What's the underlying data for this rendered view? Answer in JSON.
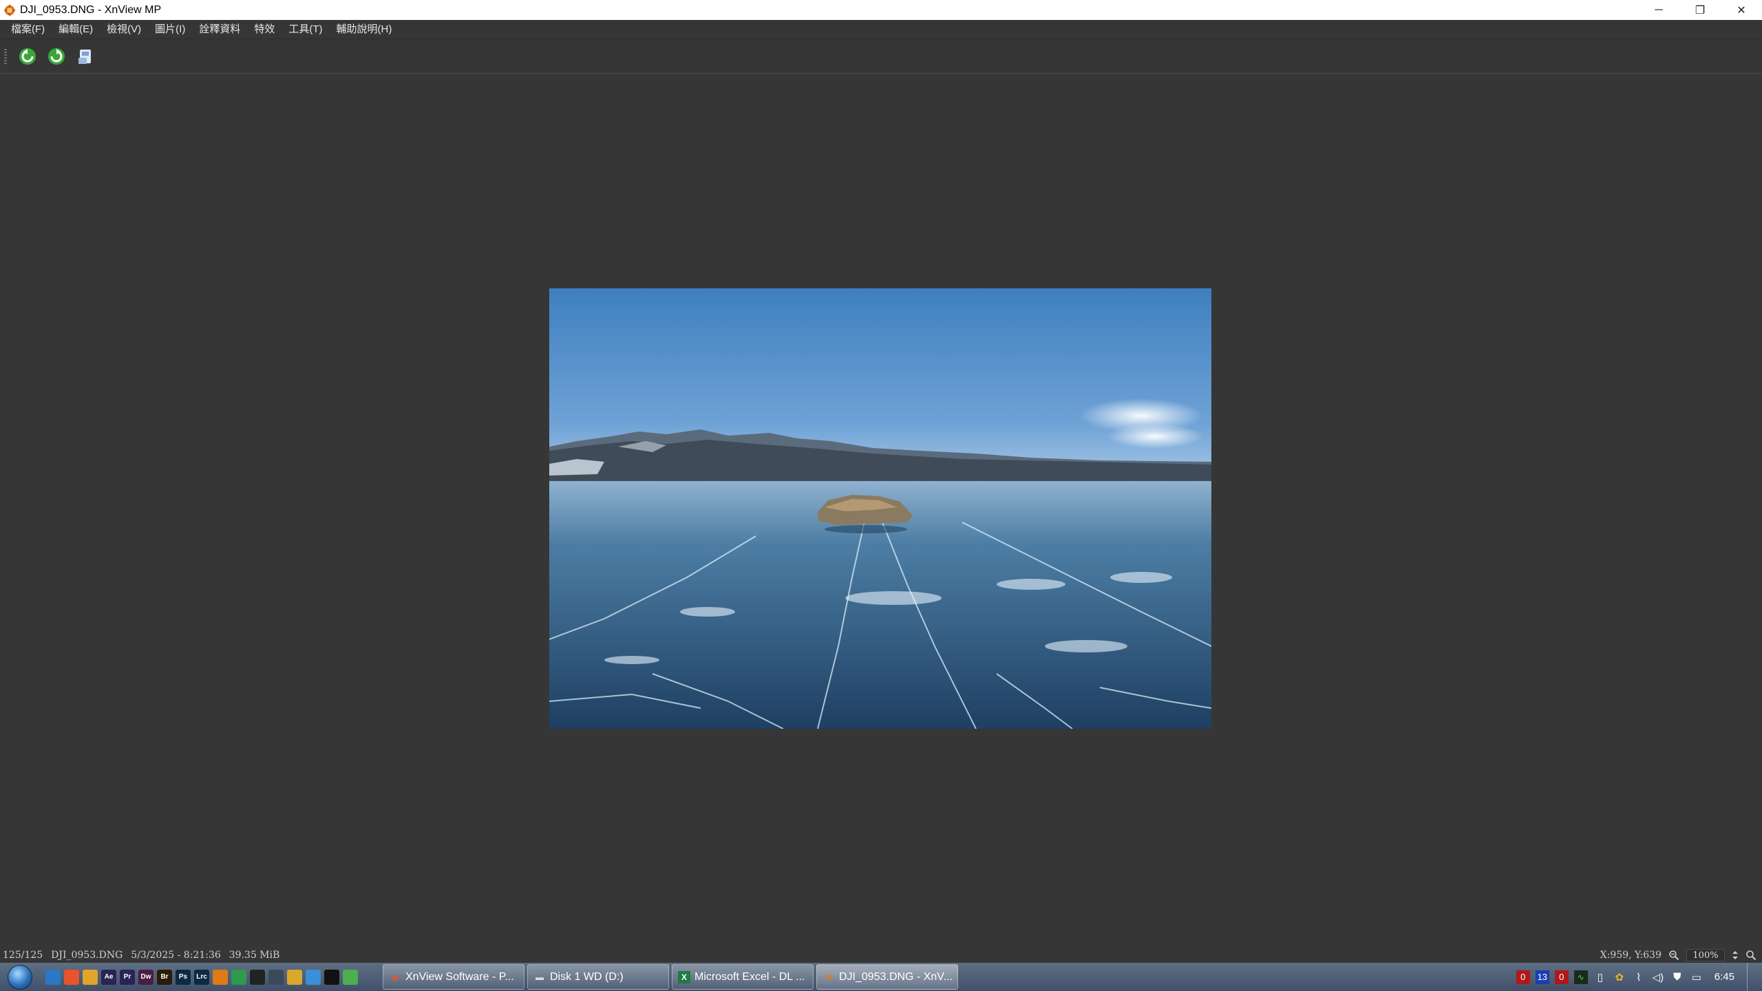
{
  "window": {
    "title": "DJI_0953.DNG - XnView MP",
    "minimize_label": "─",
    "restore_label": "❐",
    "close_label": "✕"
  },
  "menu": [
    {
      "label": "檔案(F)"
    },
    {
      "label": "編輯(E)"
    },
    {
      "label": "檢視(V)"
    },
    {
      "label": "圖片(I)"
    },
    {
      "label": "詮釋資料"
    },
    {
      "label": "特效"
    },
    {
      "label": "工具(T)"
    },
    {
      "label": "輔助說明(H)"
    }
  ],
  "toolbar": {
    "icons": [
      "rotate-left-icon",
      "rotate-right-icon",
      "save-icon"
    ]
  },
  "status": {
    "position": "125/125",
    "filename": "DJI_0953.DNG",
    "datetime": "5/3/2025 - 8:21:36",
    "filesize": "39.35 MiB",
    "cursor": "X:959, Y:639",
    "zoom": "100%"
  },
  "taskbar": {
    "quicklaunch": [
      {
        "name": "outlook",
        "label": "",
        "color": "#2a78c8"
      },
      {
        "name": "brave",
        "label": "",
        "color": "#e8542c"
      },
      {
        "name": "folder",
        "label": "",
        "color": "#e0a52a"
      },
      {
        "name": "aftereffects",
        "label": "Ae",
        "color": "#2a2355"
      },
      {
        "name": "premiere",
        "label": "Pr",
        "color": "#2a2355"
      },
      {
        "name": "dreamweaver",
        "label": "Dw",
        "color": "#4a1e44"
      },
      {
        "name": "bridge",
        "label": "Br",
        "color": "#2b1c08"
      },
      {
        "name": "photoshop",
        "label": "Ps",
        "color": "#0c2a44"
      },
      {
        "name": "lightroom",
        "label": "Lrc",
        "color": "#0c2a44"
      },
      {
        "name": "xnview",
        "label": "",
        "color": "#e07a18"
      },
      {
        "name": "app-green",
        "label": "",
        "color": "#2e9a4a"
      },
      {
        "name": "terminal",
        "label": "",
        "color": "#222222"
      },
      {
        "name": "network",
        "label": "",
        "color": "#3a4a5a"
      },
      {
        "name": "chrome-dev",
        "label": "",
        "color": "#d9a82b"
      },
      {
        "name": "app-blue",
        "label": "",
        "color": "#3a8fd8"
      },
      {
        "name": "qq",
        "label": "",
        "color": "#111111"
      },
      {
        "name": "chrome",
        "label": "",
        "color": "#4caf50"
      }
    ],
    "tasks": [
      {
        "label": "XnView Software - P...",
        "icon": "brave-icon",
        "active": false
      },
      {
        "label": "Disk 1 WD (D:)",
        "icon": "drive-icon",
        "active": false
      },
      {
        "label": "Microsoft Excel - DL ...",
        "icon": "excel-icon",
        "active": false
      },
      {
        "label": "DJI_0953.DNG - XnV...",
        "icon": "xnview-icon",
        "active": true
      }
    ],
    "tray": {
      "badge1": "0",
      "badge2": "13",
      "badge3": "0",
      "clock": "6:45"
    }
  }
}
